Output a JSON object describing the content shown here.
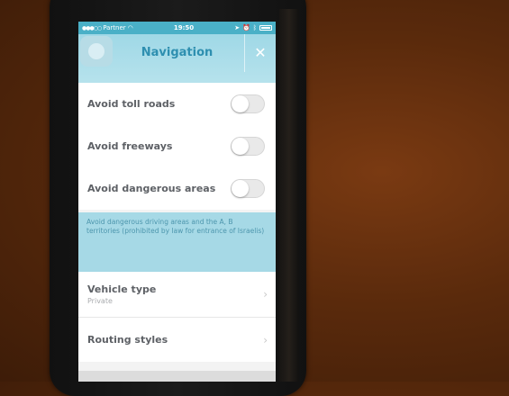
{
  "status_bar": {
    "carrier": "Partner",
    "time": "19:50"
  },
  "header": {
    "title": "Navigation",
    "close_icon": "close-icon"
  },
  "settings": [
    {
      "label": "Avoid toll roads",
      "enabled": false
    },
    {
      "label": "Avoid freeways",
      "enabled": false
    },
    {
      "label": "Avoid dangerous areas",
      "enabled": false
    }
  ],
  "info": {
    "text": "Avoid dangerous driving areas and the A, B territories (prohibited by law for entrance of Israelis)"
  },
  "rows": [
    {
      "label": "Vehicle type",
      "value": "Private"
    },
    {
      "label": "Routing styles",
      "value": ""
    }
  ],
  "colors": {
    "accent": "#2e8fb0",
    "header_bg": "#a6d9e6"
  }
}
